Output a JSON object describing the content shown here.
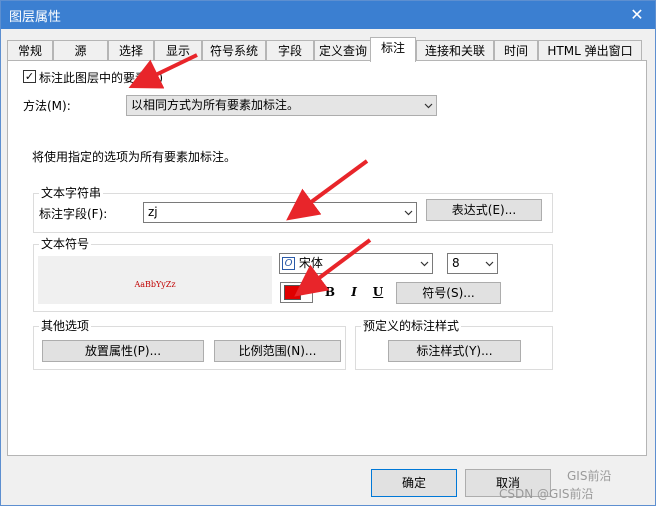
{
  "window": {
    "title": "图层属性"
  },
  "tabs": [
    {
      "label": "常规"
    },
    {
      "label": "源"
    },
    {
      "label": "选择"
    },
    {
      "label": "显示"
    },
    {
      "label": "符号系统"
    },
    {
      "label": "字段"
    },
    {
      "label": "定义查询"
    },
    {
      "label": "标注"
    },
    {
      "label": "连接和关联"
    },
    {
      "label": "时间"
    },
    {
      "label": "HTML 弹出窗口"
    }
  ],
  "active_tab": "标注",
  "label_checkbox": {
    "label": "标注此图层中的要素(L)",
    "checked": true,
    "mark": "✓"
  },
  "method": {
    "label": "方法(M):",
    "value": "以相同方式为所有要素加标注。"
  },
  "info_text": "将使用指定的选项为所有要素加标注。",
  "text_string": {
    "group_title": "文本字符串",
    "field_label": "标注字段(F):",
    "field_value": "zj",
    "expression_button": "表达式(E)..."
  },
  "text_symbol": {
    "group_title": "文本符号",
    "preview_text": "AaBbYyZz",
    "font_icon_glyph": "O",
    "font_name": "宋体",
    "font_size": "8",
    "color": "#e00000",
    "bold_label": "B",
    "italic_label": "I",
    "underline_label": "U",
    "symbol_button": "符号(S)..."
  },
  "other_options": {
    "group_title": "其他选项",
    "placement_button": "放置属性(P)...",
    "scale_button": "比例范围(N)..."
  },
  "predefined": {
    "group_title": "预定义的标注样式",
    "style_button": "标注样式(Y)..."
  },
  "footer": {
    "ok_label": "确定",
    "cancel_label": "取消"
  },
  "watermark": {
    "brand": "GIS前沿",
    "credit": "CSDN @GIS前沿"
  }
}
